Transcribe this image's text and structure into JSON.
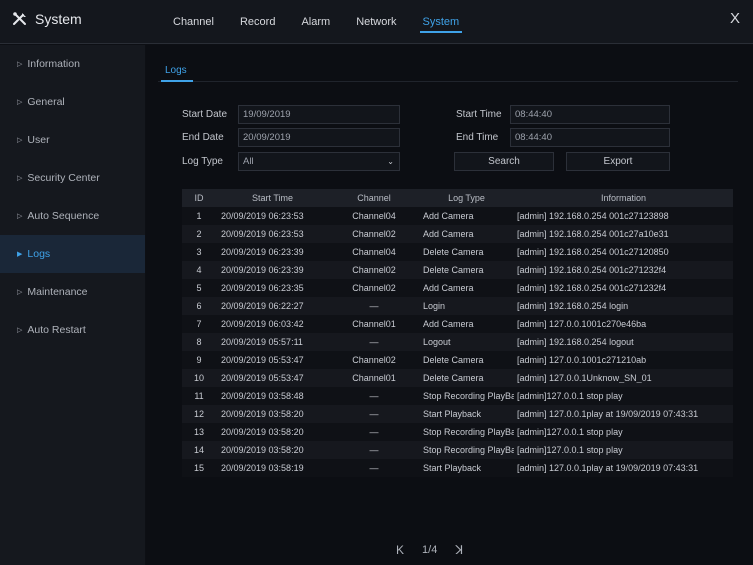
{
  "app": {
    "title": "System",
    "logo_icon": "tools-icon",
    "close_glyph": "X"
  },
  "top_tabs": [
    {
      "label": "Channel",
      "active": false
    },
    {
      "label": "Record",
      "active": false
    },
    {
      "label": "Alarm",
      "active": false
    },
    {
      "label": "Network",
      "active": false
    },
    {
      "label": "System",
      "active": true
    }
  ],
  "sidebar": {
    "items": [
      {
        "label": "Information",
        "active": false
      },
      {
        "label": "General",
        "active": false
      },
      {
        "label": "User",
        "active": false
      },
      {
        "label": "Security Center",
        "active": false
      },
      {
        "label": "Auto Sequence",
        "active": false
      },
      {
        "label": "Logs",
        "active": true
      },
      {
        "label": "Maintenance",
        "active": false
      },
      {
        "label": "Auto Restart",
        "active": false
      }
    ]
  },
  "subtab": {
    "label": "Logs"
  },
  "filters": {
    "start_date_label": "Start Date",
    "start_date_value": "19/09/2019",
    "end_date_label": "End Date",
    "end_date_value": "20/09/2019",
    "log_type_label": "Log Type",
    "log_type_value": "All",
    "start_time_label": "Start Time",
    "start_time_value": "08:44:40",
    "end_time_label": "End Time",
    "end_time_value": "08:44:40",
    "search_label": "Search",
    "export_label": "Export"
  },
  "table": {
    "headers": {
      "id": "ID",
      "time": "Start Time",
      "channel": "Channel",
      "type": "Log Type",
      "info": "Information"
    },
    "rows": [
      {
        "id": "1",
        "time": "20/09/2019 06:23:53",
        "channel": "Channel04",
        "type": "Add Camera",
        "info": "[admin] 192.168.0.254 001c27123898"
      },
      {
        "id": "2",
        "time": "20/09/2019 06:23:53",
        "channel": "Channel02",
        "type": "Add Camera",
        "info": "[admin] 192.168.0.254 001c27a10e31"
      },
      {
        "id": "3",
        "time": "20/09/2019 06:23:39",
        "channel": "Channel04",
        "type": "Delete Camera",
        "info": "[admin] 192.168.0.254 001c27120850"
      },
      {
        "id": "4",
        "time": "20/09/2019 06:23:39",
        "channel": "Channel02",
        "type": "Delete Camera",
        "info": "[admin] 192.168.0.254 001c271232f4"
      },
      {
        "id": "5",
        "time": "20/09/2019 06:23:35",
        "channel": "Channel02",
        "type": "Add Camera",
        "info": "[admin] 192.168.0.254 001c271232f4"
      },
      {
        "id": "6",
        "time": "20/09/2019 06:22:27",
        "channel": "—",
        "type": "Login",
        "info": "[admin] 192.168.0.254 login"
      },
      {
        "id": "7",
        "time": "20/09/2019 06:03:42",
        "channel": "Channel01",
        "type": "Add Camera",
        "info": "[admin] 127.0.0.1001c270e46ba"
      },
      {
        "id": "8",
        "time": "20/09/2019 05:57:11",
        "channel": "—",
        "type": "Logout",
        "info": "[admin] 192.168.0.254 logout"
      },
      {
        "id": "9",
        "time": "20/09/2019 05:53:47",
        "channel": "Channel02",
        "type": "Delete Camera",
        "info": "[admin] 127.0.0.1001c271210ab"
      },
      {
        "id": "10",
        "time": "20/09/2019 05:53:47",
        "channel": "Channel01",
        "type": "Delete Camera",
        "info": "[admin] 127.0.0.1Unknow_SN_01"
      },
      {
        "id": "11",
        "time": "20/09/2019 03:58:48",
        "channel": "—",
        "type": "Stop Recording PlayBack",
        "info": "[admin]127.0.0.1 stop play"
      },
      {
        "id": "12",
        "time": "20/09/2019 03:58:20",
        "channel": "—",
        "type": "Start Playback",
        "info": "[admin] 127.0.0.1play at 19/09/2019 07:43:31"
      },
      {
        "id": "13",
        "time": "20/09/2019 03:58:20",
        "channel": "—",
        "type": "Stop Recording PlayBack",
        "info": "[admin]127.0.0.1 stop play"
      },
      {
        "id": "14",
        "time": "20/09/2019 03:58:20",
        "channel": "—",
        "type": "Stop Recording PlayBack",
        "info": "[admin]127.0.0.1 stop play"
      },
      {
        "id": "15",
        "time": "20/09/2019 03:58:19",
        "channel": "—",
        "type": "Start Playback",
        "info": "[admin] 127.0.0.1play at 19/09/2019 07:43:31"
      }
    ]
  },
  "pagination": {
    "prev_glyph": "K",
    "page_text": "1/4",
    "next_glyph": "ꓘ"
  },
  "colors": {
    "accent": "#3fa2e8",
    "background": "#0d0f14",
    "sidebar": "#15181e"
  }
}
